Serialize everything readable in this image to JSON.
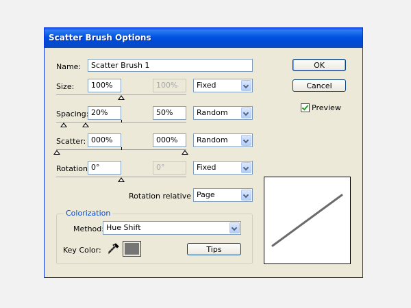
{
  "window": {
    "title": "Scatter Brush Options"
  },
  "name_row": {
    "label": "Name:",
    "value": "Scatter Brush 1"
  },
  "size_row": {
    "label": "Size:",
    "min_value": "100%",
    "max_value": "100%",
    "mode": "Fixed"
  },
  "spacing_row": {
    "label": "Spacing:",
    "min_value": "20%",
    "max_value": "50%",
    "mode": "Random"
  },
  "scatter_row": {
    "label": "Scatter:",
    "min_value": "000%",
    "max_value": "000%",
    "mode": "Random"
  },
  "rotation_row": {
    "label": "Rotation:",
    "min_value": "0°",
    "max_value": "0°",
    "mode": "Fixed"
  },
  "rotation_relative": {
    "label": "Rotation relative to:",
    "value": "Page"
  },
  "colorization": {
    "group_label": "Colorization",
    "method_label": "Method:",
    "method_value": "Hue Shift",
    "key_color_label": "Key Color:",
    "key_color": "#757575",
    "tips_label": "Tips"
  },
  "buttons": {
    "ok": "OK",
    "cancel": "Cancel"
  },
  "preview": {
    "label": "Preview",
    "checked": true
  },
  "colors": {
    "titlebar": "#0053e1",
    "dialog_bg": "#ece9d8",
    "preview_stroke": "#6b6b6b"
  }
}
